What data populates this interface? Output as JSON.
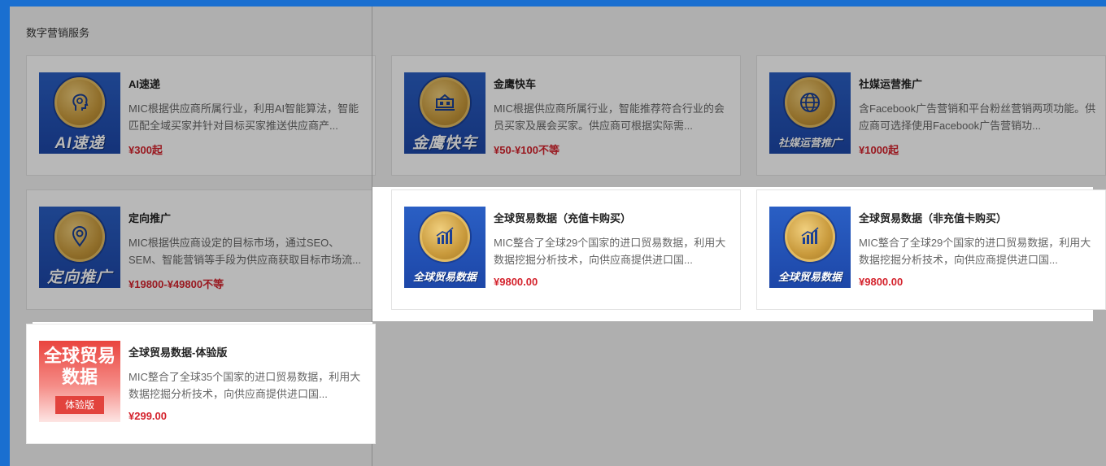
{
  "section": {
    "title": "数字营销服务"
  },
  "cards": [
    {
      "title": "AI速递",
      "desc": "MIC根据供应商所属行业，利用AI智能算法，智能匹配全域买家并针对目标买家推送供应商产...",
      "price": "¥300起",
      "thumb_label": "AI速递",
      "icon": "ai-head-icon"
    },
    {
      "title": "金鹰快车",
      "desc": "MIC根据供应商所属行业，智能推荐符合行业的会员买家及展会买家。供应商可根据实际需...",
      "price": "¥50-¥100不等",
      "thumb_label": "金鹰快车",
      "icon": "express-train-icon"
    },
    {
      "title": "社媒运营推广",
      "desc": "含Facebook广告营销和平台粉丝营销两项功能。供应商可选择使用Facebook广告营销功...",
      "price": "¥1000起",
      "thumb_label": "社媒运营推广",
      "icon": "globe-icon"
    },
    {
      "title": "定向推广",
      "desc": "MIC根据供应商设定的目标市场，通过SEO、SEM、智能营销等手段为供应商获取目标市场流...",
      "price": "¥19800-¥49800不等",
      "thumb_label": "定向推广",
      "icon": "location-pin-icon"
    },
    {
      "title": "全球贸易数据（充值卡购买）",
      "desc": "MIC整合了全球29个国家的进口贸易数据，利用大数据挖掘分析技术，向供应商提供进口国...",
      "price": "¥9800.00",
      "thumb_label": "全球贸易数据",
      "icon": "bar-chart-icon"
    },
    {
      "title": "全球贸易数据（非充值卡购买）",
      "desc": "MIC整合了全球29个国家的进口贸易数据，利用大数据挖掘分析技术，向供应商提供进口国...",
      "price": "¥9800.00",
      "thumb_label": "全球贸易数据",
      "icon": "bar-chart-icon"
    },
    {
      "title": "全球贸易数据-体验版",
      "desc": "MIC整合了全球35个国家的进口贸易数据，利用大数据挖掘分析技术，向供应商提供进口国...",
      "price": "¥299.00",
      "thumb_title": "全球贸易数据",
      "thumb_badge": "体验版"
    }
  ],
  "colors": {
    "price": "#d4232d",
    "thumb_blue": "#2a5fc4",
    "medal_gold": "#c99a3c",
    "trial_red": "#e2433d"
  }
}
